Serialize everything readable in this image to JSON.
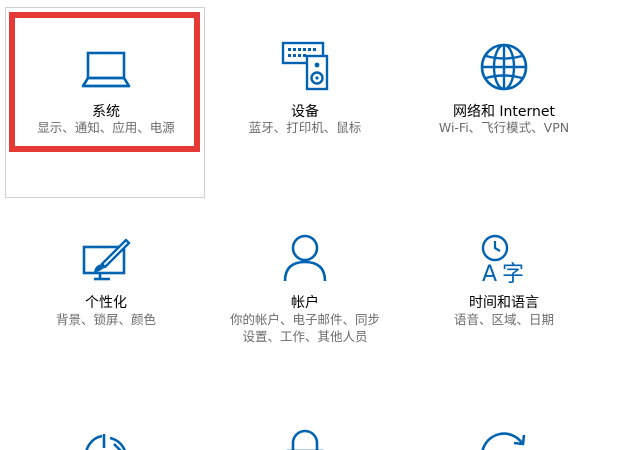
{
  "colors": {
    "icon": "#0063b1",
    "title": "#000000",
    "desc": "#6b6b6b",
    "highlight": "#e53935"
  },
  "tiles": [
    {
      "icon": "laptop-icon",
      "title": "系统",
      "desc1": "显示、通知、应用、电源"
    },
    {
      "icon": "devices-icon",
      "title": "设备",
      "desc1": "蓝牙、打印机、鼠标"
    },
    {
      "icon": "globe-icon",
      "title": "网络和 Internet",
      "desc1": "Wi-Fi、飞行模式、VPN"
    },
    {
      "icon": "personalization-icon",
      "title": "个性化",
      "desc1": "背景、锁屏、颜色"
    },
    {
      "icon": "person-icon",
      "title": "帐户",
      "desc1": "你的帐户、电子邮件、同步",
      "desc2": "设置、工作、其他人员"
    },
    {
      "icon": "time-language-icon",
      "title": "时间和语言",
      "desc1": "语音、区域、日期"
    },
    {
      "icon": "ease-of-access-icon"
    },
    {
      "icon": "privacy-lock-icon"
    },
    {
      "icon": "update-icon"
    }
  ]
}
